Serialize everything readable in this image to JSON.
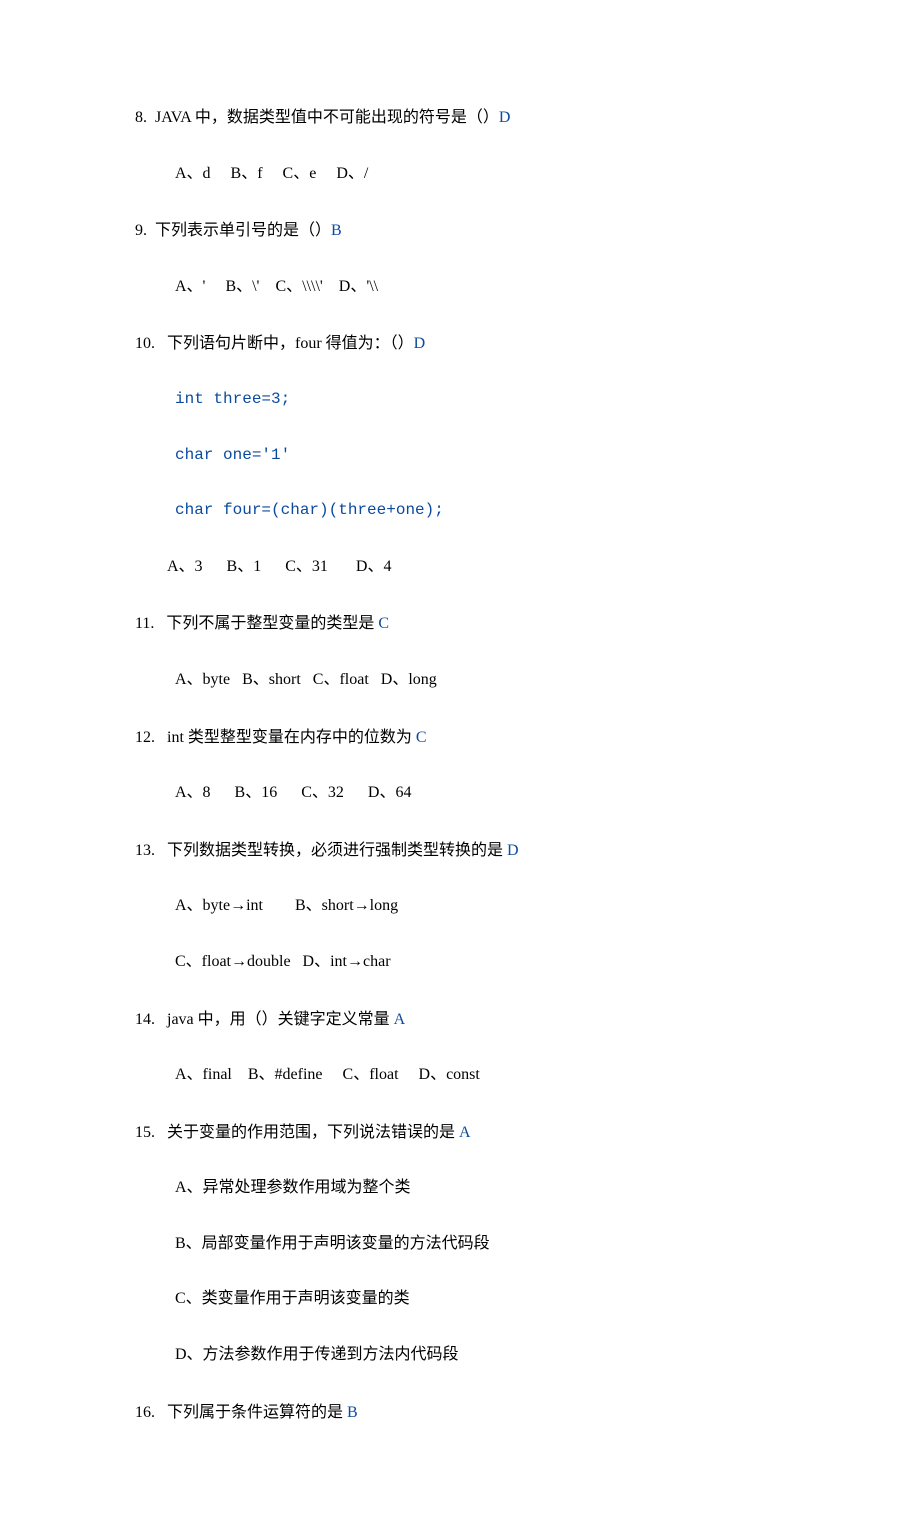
{
  "q8": {
    "num": "8.  ",
    "stem_a": "JAVA 中，数据类型值中不可能出现的符号是（）",
    "ans": "D",
    "opts": "A、d     B、f     C、e     D、/"
  },
  "q9": {
    "num": "9.  ",
    "stem_a": "下列表示单引号的是（）",
    "ans": "B",
    "opts": "A、'     B、\\'    C、\\\\\\\\'    D、'\\\\"
  },
  "q10": {
    "num": "10.   ",
    "stem_a": "下列语句片断中，four 得值为：（）",
    "ans": "D",
    "c1": "int three=3;",
    "c2": "char one='1'",
    "c3": "char four=(char)(three+one);",
    "opts": "A、3      B、1      C、31       D、4"
  },
  "q11": {
    "num": "11.   ",
    "stem_a": "下列不属于整型变量的类型是 ",
    "ans": "C",
    "opts": "A、byte   B、short   C、float   D、long"
  },
  "q12": {
    "num": "12.   ",
    "stem_a": "int 类型整型变量在内存中的位数为 ",
    "ans": "C",
    "opts": "A、8      B、16      C、32      D、64"
  },
  "q13": {
    "num": "13.   ",
    "stem_a": "下列数据类型转换，必须进行强制类型转换的是 ",
    "ans": "D",
    "opts1": "A、byte→int        B、short→long",
    "opts2": "C、float→double   D、int→char"
  },
  "q14": {
    "num": "14.   ",
    "stem_a": "java 中，用（）关键字定义常量 ",
    "ans": "A",
    "opts": "A、final    B、#define     C、float     D、const"
  },
  "q15": {
    "num": "15.   ",
    "stem_a": "关于变量的作用范围，下列说法错误的是 ",
    "ans": "A",
    "oA": "A、异常处理参数作用域为整个类",
    "oB": "B、局部变量作用于声明该变量的方法代码段",
    "oC": "C、类变量作用于声明该变量的类",
    "oD": "D、方法参数作用于传递到方法内代码段"
  },
  "q16": {
    "num": "16.   ",
    "stem_a": "下列属于条件运算符的是 ",
    "ans": "B"
  }
}
